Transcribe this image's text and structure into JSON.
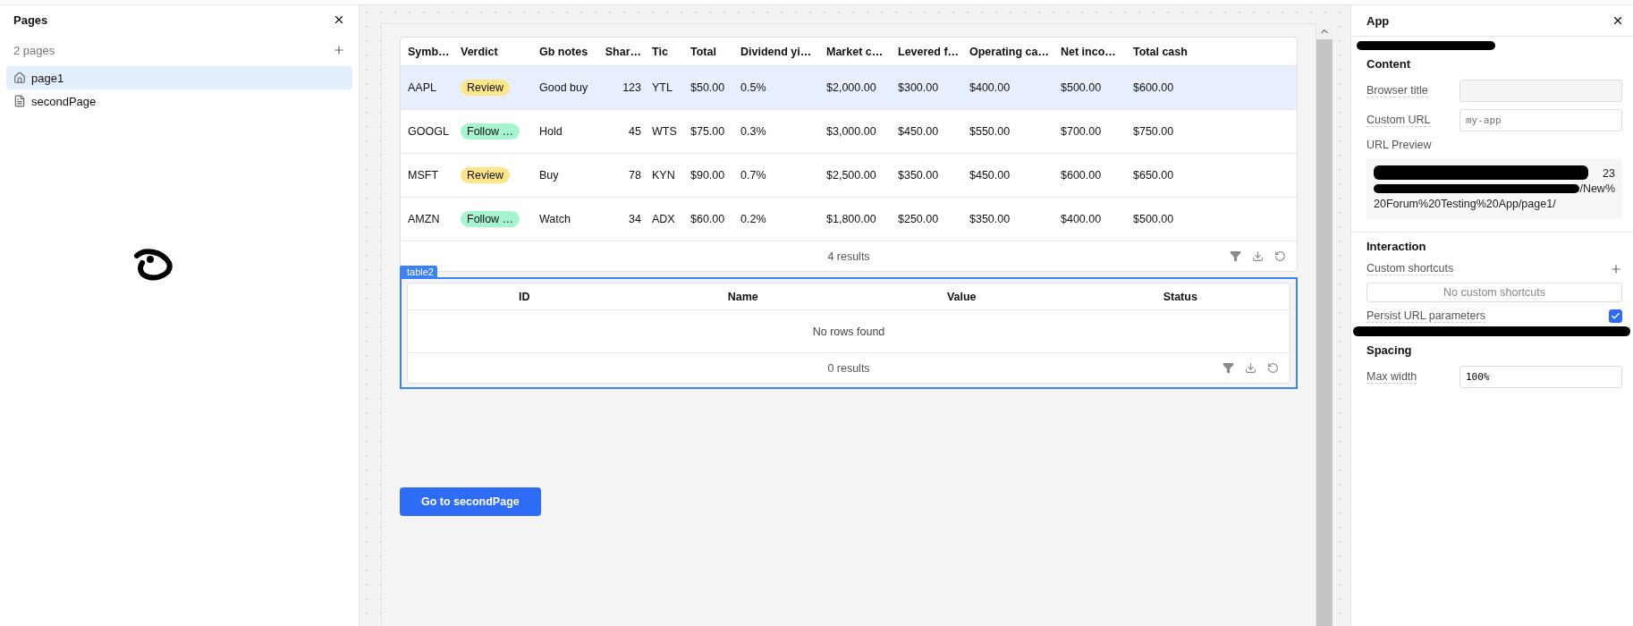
{
  "pages_panel": {
    "title": "Pages",
    "count": "2 pages",
    "items": [
      {
        "label": "page1",
        "kind": "home",
        "selected": true
      },
      {
        "label": "secondPage",
        "kind": "page",
        "selected": false
      }
    ]
  },
  "table1": {
    "columns": [
      "Symb…",
      "Verdict",
      "Gb notes",
      "Shar…",
      "Tic",
      "Total",
      "Dividend yi…",
      "Market c…",
      "Levered f…",
      "Operating ca…",
      "Net inco…",
      "Total cash"
    ],
    "rows": [
      {
        "selected": true,
        "cells": [
          "AAPL",
          {
            "tag": "Review",
            "color": "#fde68a"
          },
          "Good buy",
          "123",
          "YTL",
          "$50.00",
          "0.5%",
          "$2,000.00",
          "$300.00",
          "$400.00",
          "$500.00",
          "$600.00"
        ]
      },
      {
        "selected": false,
        "cells": [
          "GOOGL",
          {
            "tag": "Follow …",
            "color": "#a7f3d0"
          },
          "Hold",
          "45",
          "WTS",
          "$75.00",
          "0.3%",
          "$3,000.00",
          "$450.00",
          "$550.00",
          "$700.00",
          "$750.00"
        ]
      },
      {
        "selected": false,
        "cells": [
          "MSFT",
          {
            "tag": "Review",
            "color": "#fde68a"
          },
          "Buy",
          "78",
          "KYN",
          "$90.00",
          "0.7%",
          "$2,500.00",
          "$350.00",
          "$450.00",
          "$600.00",
          "$650.00"
        ]
      },
      {
        "selected": false,
        "cells": [
          "AMZN",
          {
            "tag": "Follow …",
            "color": "#a7f3d0"
          },
          "Watch",
          "34",
          "ADX",
          "$60.00",
          "0.2%",
          "$1,800.00",
          "$250.00",
          "$350.00",
          "$400.00",
          "$500.00"
        ]
      }
    ],
    "footer": "4 results"
  },
  "table2": {
    "label": "table2",
    "columns": [
      "ID",
      "Name",
      "Value",
      "Status"
    ],
    "empty": "No rows found",
    "footer": "0 results"
  },
  "button": {
    "label": "Go to secondPage"
  },
  "app_panel": {
    "title": "App",
    "content": {
      "heading": "Content",
      "browser_title": {
        "label": "Browser title"
      },
      "custom_url": {
        "label": "Custom URL",
        "placeholder": "my-app"
      },
      "url_preview": {
        "label": "URL Preview",
        "fragments": [
          "23",
          "/New%"
        ],
        "text": "20Forum%20Testing%20App/page1/"
      }
    },
    "interaction": {
      "heading": "Interaction",
      "shortcuts_label": "Custom shortcuts",
      "shortcuts_empty": "No custom shortcuts",
      "persist_label": "Persist URL parameters",
      "persist_checked": true
    },
    "spacing": {
      "heading": "Spacing",
      "max_width": {
        "label": "Max width",
        "value": "100%"
      }
    }
  }
}
